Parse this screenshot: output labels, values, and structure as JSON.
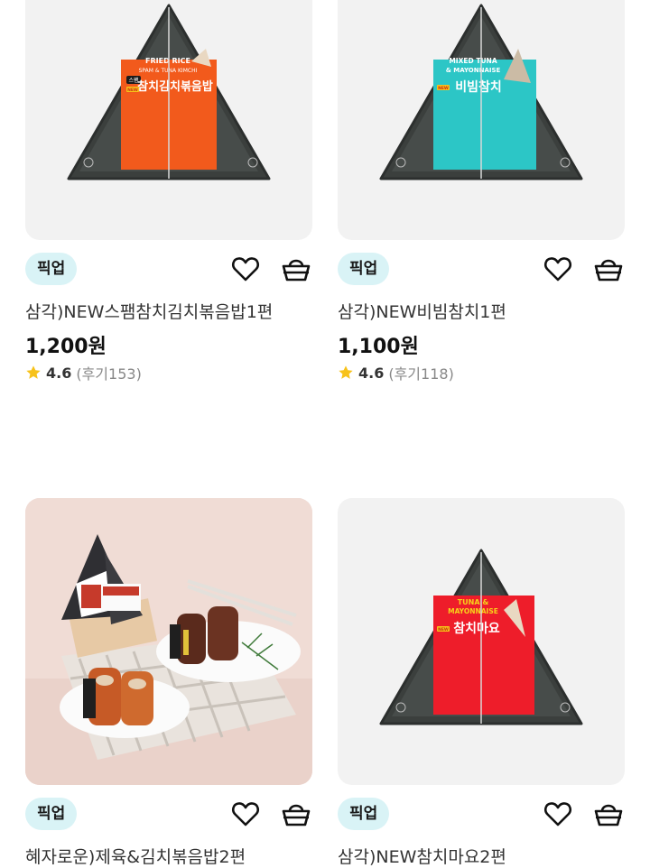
{
  "products": [
    {
      "badge": "픽업",
      "name": "삼각)NEW스팸참치김치볶음밥1편",
      "price": "1,200원",
      "rating": "4.6",
      "reviews": "(후기153)",
      "pack": {
        "en1": "FRIED RICE",
        "en2": "SPAM & TUNA KIMCHI",
        "new": "NEW",
        "tag": "스팸",
        "ko": "참치김치볶음밥",
        "color": "#f25a1c"
      }
    },
    {
      "badge": "픽업",
      "name": "삼각)NEW비빔참치1편",
      "price": "1,100원",
      "rating": "4.6",
      "reviews": "(후기118)",
      "pack": {
        "en1": "MIXED TUNA",
        "en2": "& MAYONNAISE",
        "new": "NEW",
        "ko": "비빔참치",
        "color": "#2cc6c6"
      }
    },
    {
      "badge": "픽업",
      "name": "혜자로운)제육&김치볶음밥2편"
    },
    {
      "badge": "픽업",
      "name": "삼각)NEW참치마요2편",
      "pack": {
        "en1": "TUNA &",
        "en2": "MAYONNAISE",
        "new": "NEW",
        "ko": "참치마요",
        "color": "#ee1d2a"
      }
    }
  ],
  "colors": {
    "accent_badge_bg": "#d9f3f6",
    "star": "#f7c21a"
  },
  "icons": {
    "wish": "heart-icon",
    "cart": "basket-icon",
    "rating": "star-icon"
  }
}
